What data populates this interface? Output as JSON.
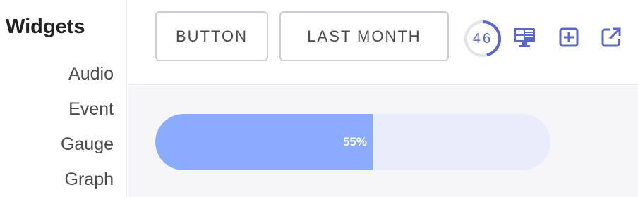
{
  "sidebar": {
    "title": "Widgets",
    "items": [
      {
        "label": "Audio"
      },
      {
        "label": "Event"
      },
      {
        "label": "Gauge"
      },
      {
        "label": "Graph"
      }
    ]
  },
  "toolbar": {
    "button_label": "BUTTON",
    "last_month_label": "LAST MONTH",
    "gauge": {
      "value": "46",
      "fraction": 0.46
    },
    "icons": [
      "monitor-icon",
      "add-box-icon",
      "open-in-new-icon"
    ]
  },
  "content": {
    "progress": {
      "value": 0.55,
      "label": "55%"
    }
  },
  "colors": {
    "accent": "#5a66c8",
    "progress_fill": "#8aacff",
    "progress_track": "#e9ecfa",
    "content_bg": "#f6f5f9"
  }
}
